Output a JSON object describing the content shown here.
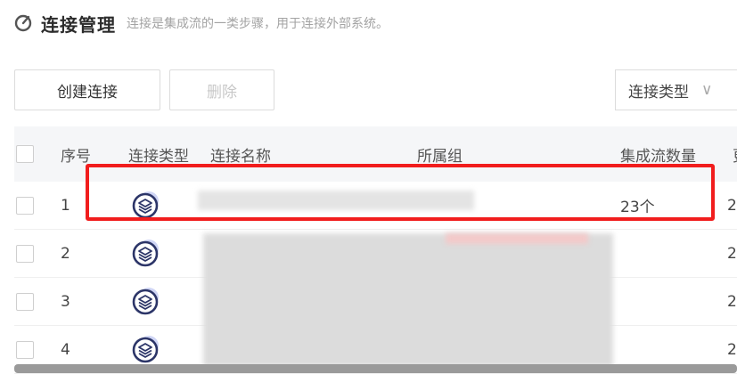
{
  "header": {
    "title": "连接管理",
    "description": "连接是集成流的一类步骤，用于连接外部系统。"
  },
  "toolbar": {
    "create_label": "创建连接",
    "delete_label": "删除",
    "filter_selected": "连接类型",
    "chevron": "∨"
  },
  "table": {
    "columns": [
      "序号",
      "连接类型",
      "连接名称",
      "所属组",
      "集成流数量",
      "更"
    ],
    "rows": [
      {
        "index": "1",
        "type_icon": "stack-layers-icon",
        "count": "23个",
        "extra": "2"
      },
      {
        "index": "2",
        "type_icon": "stack-layers-icon",
        "count": "",
        "extra": "2"
      },
      {
        "index": "3",
        "type_icon": "stack-layers-icon",
        "count": "",
        "extra": "2"
      },
      {
        "index": "4",
        "type_icon": "stack-layers-icon",
        "count": "",
        "extra": "2"
      }
    ]
  },
  "colors": {
    "highlight": "#f11d1d",
    "icon_navy": "#2c3568",
    "icon_glow": "#cfd5f5"
  }
}
